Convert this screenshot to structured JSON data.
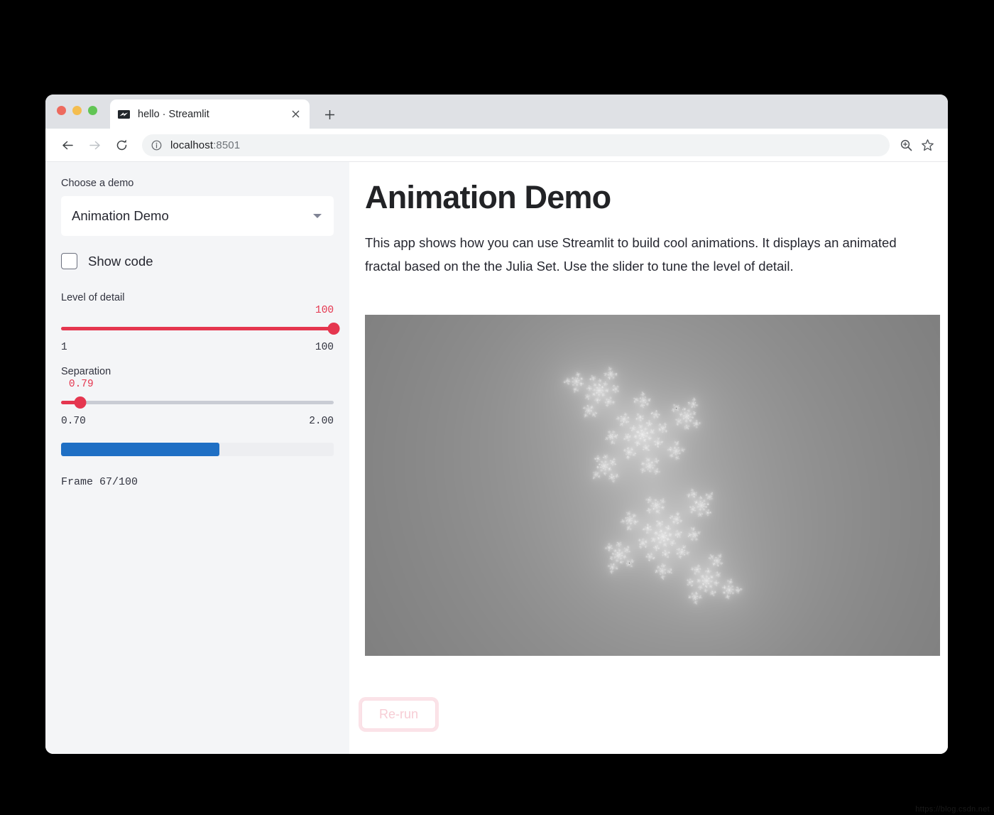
{
  "browser": {
    "tab": {
      "title": "hello · Streamlit",
      "favicon_name": "streamlit-favicon",
      "close_label": "✕"
    },
    "new_tab_label": "+",
    "nav": {
      "back_label": "←",
      "forward_label": "→",
      "reload_label": "⟳"
    },
    "omnibox": {
      "info_label": "ⓘ",
      "host": "localhost",
      "port": ":8501"
    },
    "actions": {
      "zoom_label": "zoom-in-icon",
      "bookmark_label": "star-icon"
    },
    "traffic_lights": [
      "close",
      "minimize",
      "maximize"
    ]
  },
  "sidebar": {
    "demo_label": "Choose a demo",
    "demo_selected": "Animation Demo",
    "demo_options": [
      "Animation Demo"
    ],
    "show_code": {
      "label": "Show code",
      "checked": false
    },
    "detail_slider": {
      "title": "Level of detail",
      "value": "100",
      "min": "1",
      "max": "100",
      "percent": 100
    },
    "separation_slider": {
      "title": "Separation",
      "value": "0.79",
      "min": "0.70",
      "max": "2.00",
      "percent": 7
    },
    "progress": {
      "percent": 58
    },
    "frame_status": "Frame 67/100"
  },
  "main": {
    "title": "Animation Demo",
    "description": "This app shows how you can use Streamlit to build cool animations. It displays an animated fractal based on the the Julia Set. Use the slider to tune the level of detail.",
    "rerun_label": "Re-run",
    "fractal_name": "julia-set-fractal"
  },
  "watermark": "https://blog.csdn.net",
  "colors": {
    "accent_red": "#e5364f",
    "progress_blue": "#1f6fc4",
    "sidebar_bg": "#f4f5f7",
    "page_bg": "#ffffff",
    "desktop_bg": "#000000"
  }
}
